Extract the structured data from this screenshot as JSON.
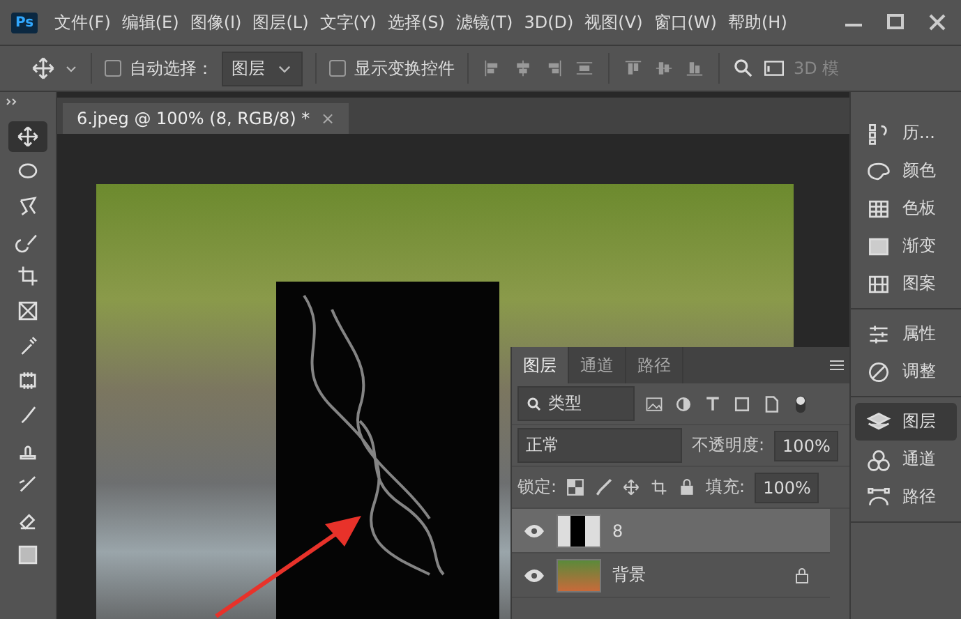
{
  "app": {
    "logo": "Ps"
  },
  "menu": [
    "文件(F)",
    "编辑(E)",
    "图像(I)",
    "图层(L)",
    "文字(Y)",
    "选择(S)",
    "滤镜(T)",
    "3D(D)",
    "视图(V)",
    "窗口(W)",
    "帮助(H)"
  ],
  "options_bar": {
    "auto_select": {
      "label": "自动选择：",
      "checked": false
    },
    "target": "图层",
    "show_transform": {
      "label": "显示变换控件",
      "checked": false
    },
    "mode_label": "3D 模"
  },
  "document_tab": {
    "title": "6.jpeg @ 100% (8, RGB/8) *",
    "close": "×",
    "selected": true
  },
  "tools": [
    {
      "kind": "move",
      "selected": true
    },
    {
      "kind": "marquee",
      "selected": false
    },
    {
      "kind": "lasso",
      "selected": false
    },
    {
      "kind": "quick-select",
      "selected": false
    },
    {
      "kind": "crop",
      "selected": false
    },
    {
      "kind": "frame",
      "selected": false
    },
    {
      "kind": "eyedropper",
      "selected": false
    },
    {
      "kind": "patch",
      "selected": false
    },
    {
      "kind": "brush",
      "selected": false
    },
    {
      "kind": "stamp",
      "selected": false
    },
    {
      "kind": "history-brush",
      "selected": false
    },
    {
      "kind": "eraser",
      "selected": false
    },
    {
      "kind": "gradient",
      "selected": false
    }
  ],
  "dock": [
    [
      {
        "kind": "history",
        "label": "历...",
        "selected": false
      },
      {
        "kind": "color",
        "label": "颜色",
        "selected": false
      },
      {
        "kind": "swatches",
        "label": "色板",
        "selected": false
      },
      {
        "kind": "gradient",
        "label": "渐变",
        "selected": false
      },
      {
        "kind": "pattern",
        "label": "图案",
        "selected": false
      }
    ],
    [
      {
        "kind": "properties",
        "label": "属性",
        "selected": false
      },
      {
        "kind": "adjust",
        "label": "调整",
        "selected": false
      }
    ],
    [
      {
        "kind": "layers",
        "label": "图层",
        "selected": true
      },
      {
        "kind": "channels",
        "label": "通道",
        "selected": false
      },
      {
        "kind": "paths",
        "label": "路径",
        "selected": false
      }
    ]
  ],
  "layers_panel": {
    "tabs": [
      {
        "label": "图层",
        "selected": true
      },
      {
        "label": "通道",
        "selected": false
      },
      {
        "label": "路径",
        "selected": false
      }
    ],
    "filter": "类型",
    "blend_mode": "正常",
    "opacity_label": "不透明度:",
    "opacity": "100%",
    "lock_label": "锁定:",
    "fill_label": "填充:",
    "fill": "100%",
    "layers": [
      {
        "name": "8",
        "kind": "smoke",
        "selected": true,
        "visible": true,
        "locked": false
      },
      {
        "name": "背景",
        "kind": "photo",
        "selected": false,
        "visible": true,
        "locked": true
      }
    ]
  }
}
